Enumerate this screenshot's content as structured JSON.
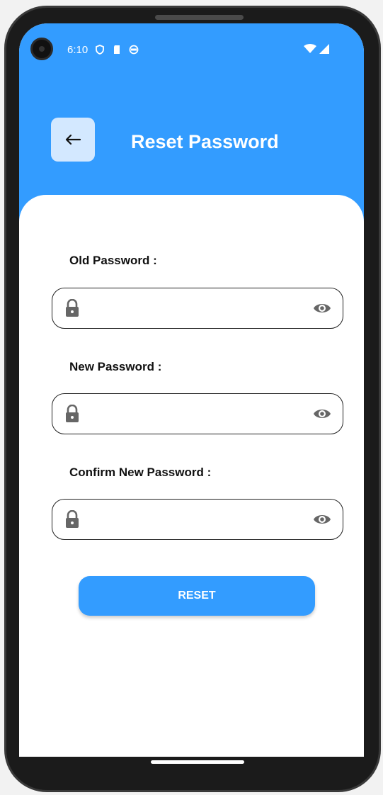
{
  "status_bar": {
    "time": "6:10"
  },
  "header": {
    "title": "Reset Password",
    "back_icon": "arrow-left-icon",
    "background": "#339cff"
  },
  "form": {
    "fields": [
      {
        "label": "Old Password :",
        "value": "",
        "lock_icon": "lock-icon",
        "toggle_icon": "eye-icon"
      },
      {
        "label": "New Password :",
        "value": "",
        "lock_icon": "lock-icon",
        "toggle_icon": "eye-icon"
      },
      {
        "label": "Confirm New Password :",
        "value": "",
        "lock_icon": "lock-icon",
        "toggle_icon": "eye-icon"
      }
    ],
    "submit_label": "RESET"
  },
  "colors": {
    "accent": "#339cff",
    "back_button_bg": "#d3e8ff",
    "icon_gray": "#666666"
  }
}
